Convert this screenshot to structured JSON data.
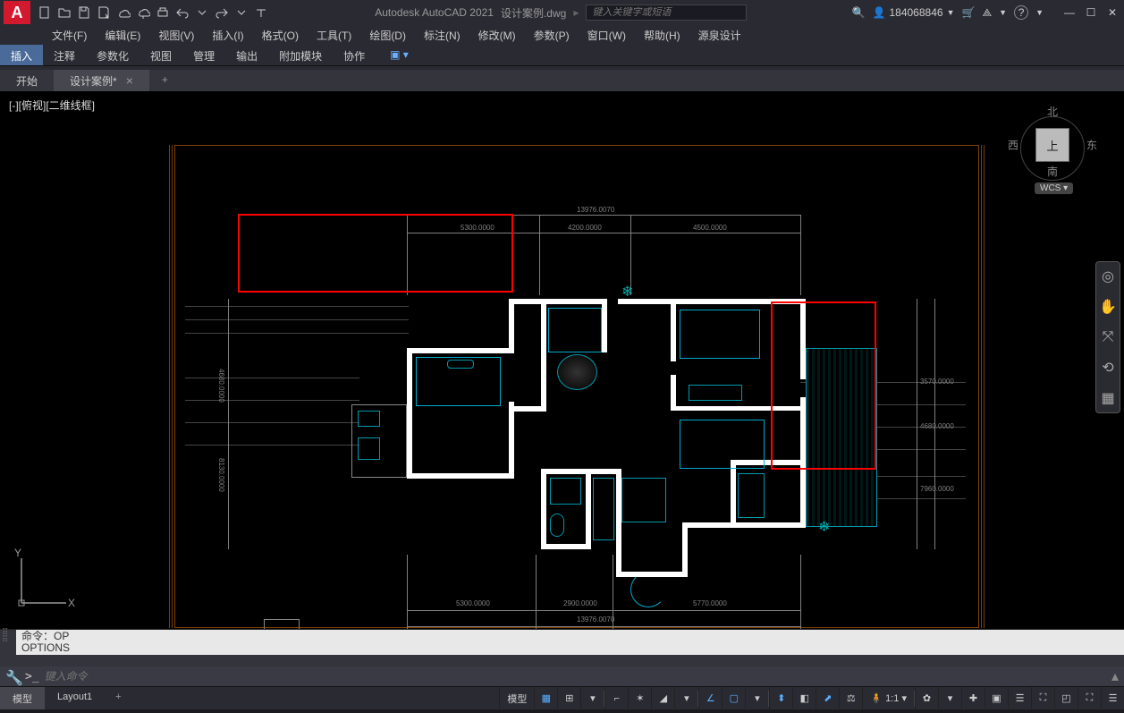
{
  "app": {
    "name": "Autodesk AutoCAD 2021",
    "doc": "设计案例.dwg"
  },
  "search": {
    "placeholder": "键入关键字或短语"
  },
  "user": {
    "name": "184068846"
  },
  "menubar": [
    "文件(F)",
    "编辑(E)",
    "视图(V)",
    "插入(I)",
    "格式(O)",
    "工具(T)",
    "绘图(D)",
    "标注(N)",
    "修改(M)",
    "参数(P)",
    "窗口(W)",
    "帮助(H)",
    "源泉设计"
  ],
  "ribbon_tabs": [
    "插入",
    "注释",
    "参数化",
    "视图",
    "管理",
    "输出",
    "附加模块",
    "协作"
  ],
  "ribbon_active": 0,
  "doc_tabs": [
    {
      "label": "开始",
      "active": false,
      "closable": false
    },
    {
      "label": "设计案例*",
      "active": true,
      "closable": true
    }
  ],
  "viewport_label": "[-][俯视][二维线框]",
  "viewcube": {
    "n": "北",
    "s": "南",
    "e": "东",
    "w": "西",
    "top": "上",
    "wcs": "WCS"
  },
  "dimensions": {
    "top_total": "13976.0070",
    "top_seg1": "5300.0000",
    "top_seg2": "4200.0000",
    "top_seg3": "4500.0000",
    "bottom_total": "13976.0070",
    "bottom_seg1": "5300.0000",
    "bottom_seg2": "2900.0000",
    "bottom_seg3": "5770.0000",
    "left_seg1": "4680.0000",
    "left_seg2": "8130.0000",
    "right_seg1": "3570.0000",
    "right_seg2": "4680.0000",
    "right_seg3": "7960.0000"
  },
  "cmd": {
    "history1": "命令：OP",
    "history2": "OPTIONS",
    "prompt": ">_",
    "placeholder": "键入命令"
  },
  "layout_tabs": [
    {
      "label": "模型",
      "active": true
    },
    {
      "label": "Layout1",
      "active": false
    }
  ],
  "status": {
    "model_label": "模型",
    "scale": "1:1"
  },
  "ucs": {
    "x": "X",
    "y": "Y"
  }
}
